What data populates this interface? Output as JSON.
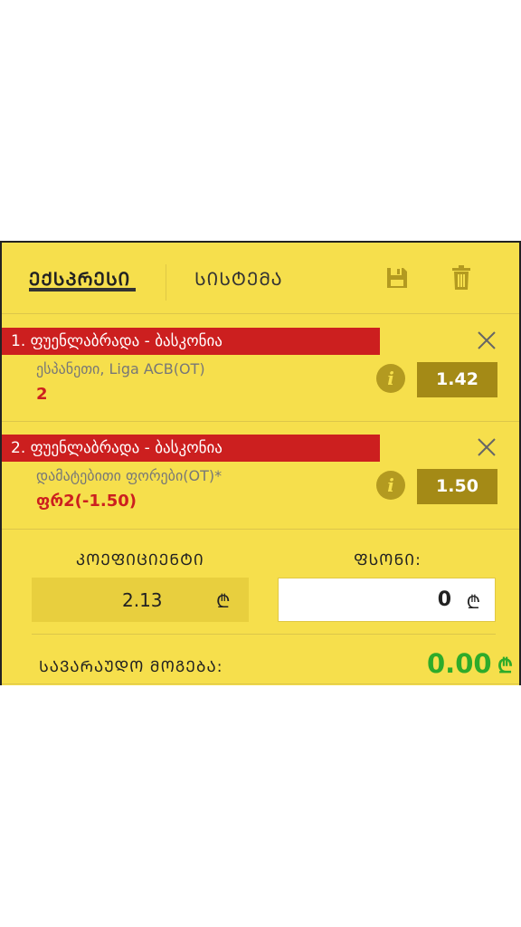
{
  "tabs": {
    "express": "ᲔᲥᲡᲞᲠᲔᲡᲘ",
    "system": "ᲡᲘᲡᲢᲔᲛᲐ"
  },
  "icons": {
    "save": "save-icon",
    "delete": "trash-icon",
    "info": "info-icon",
    "close": "close-icon"
  },
  "bets": [
    {
      "title": "1.  ფუენლაბრადა - ბასკონია",
      "league": "ესპანეთი, Liga ACB(OT)",
      "pick": "2",
      "odds": "1.42",
      "info": "i"
    },
    {
      "title": "2.  ფუენლაბრადა - ბასკონია",
      "league": "დამატებითი ფორები(OT)*",
      "pick": "ფრ2(-1.50)",
      "odds": "1.50",
      "info": "i"
    }
  ],
  "summary": {
    "coef_label": "ᲙᲝᲔᲤᲘᲪᲘᲔᲜᲢᲘ",
    "coef_value": "2.13",
    "stake_label": "ᲤᲡᲝᲜᲘ:",
    "stake_value": "0",
    "currency": "₾",
    "win_label": "ᲡᲐᲕᲐᲠᲐᲣᲓᲝ ᲛᲝᲒᲔᲑᲐ:",
    "win_value": "0.00"
  },
  "colors": {
    "panel": "#f6df4c",
    "red": "#cc1f1f",
    "odds_bg": "#a48a16",
    "green": "#2eab2a"
  }
}
